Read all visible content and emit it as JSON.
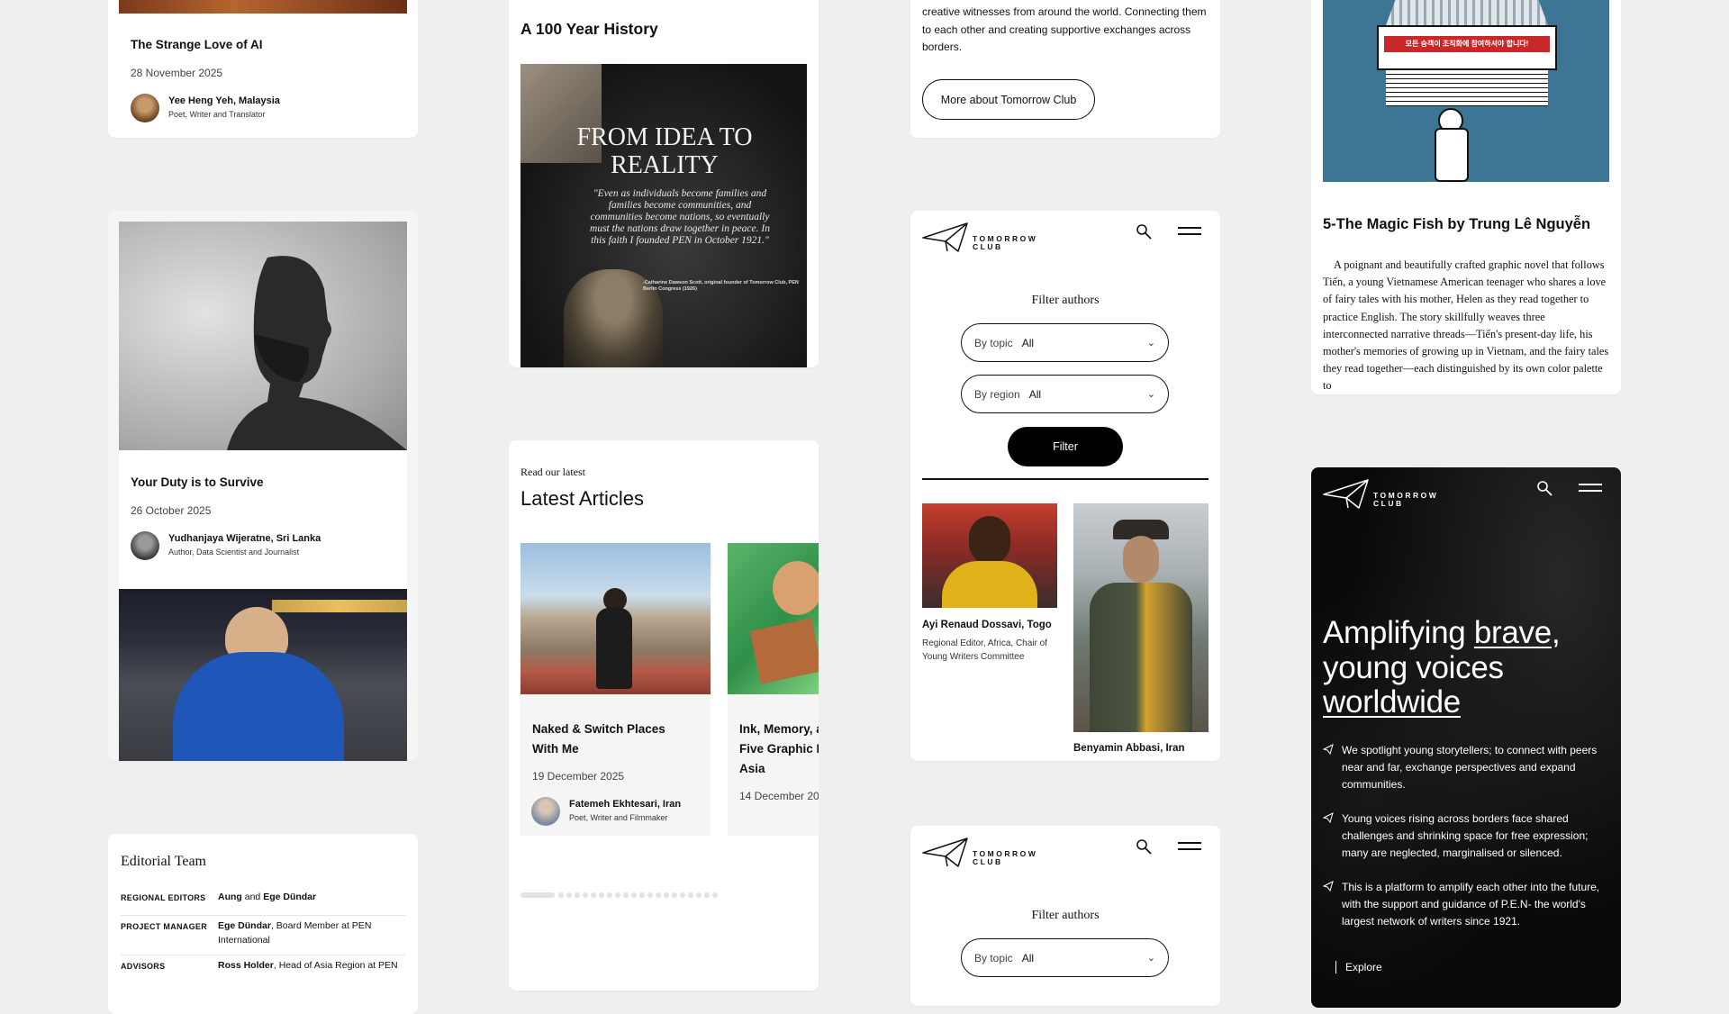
{
  "card1": {
    "title": "The Strange Love of AI",
    "date": "28 November 2025",
    "author_name": "Yee Heng Yeh, Malaysia",
    "author_role": "Poet, Writer and Translator"
  },
  "card2": {
    "title": "Your Duty is to Survive",
    "date": "26 October 2025",
    "author_name": "Yudhanjaya Wijeratne, Sri Lanka",
    "author_role": "Author, Data Scientist and Journalist"
  },
  "editorial": {
    "heading": "Editorial Team",
    "rows": [
      {
        "label": "REGIONAL EDITORS",
        "name1": "Aung",
        "joiner": " and ",
        "name2": "Ege Dündar",
        "rest": ""
      },
      {
        "label": "PROJECT MANAGER",
        "name1": "Ege Dündar",
        "joiner": "",
        "name2": "",
        "rest": ", Board Member at PEN International"
      },
      {
        "label": "ADVISORS",
        "name1": "Ross Holder",
        "joiner": "",
        "name2": "",
        "rest": ", Head of Asia Region at PEN"
      }
    ]
  },
  "history": {
    "heading": "A 100 Year History",
    "poster_title": "FROM IDEA TO REALITY",
    "poster_quote": "\"Even as individuals become families and families become communities, and communities become nations, so eventually must the nations draw together in peace. In this faith I founded PEN in October 1921.\"",
    "poster_credit": "-Catharine Dawson Scott, original founder of Tomorrow Club, PEN Berlin Congress (1926)"
  },
  "latest": {
    "eyebrow": "Read our latest",
    "heading": "Latest Articles",
    "article1": {
      "title": "Naked & Switch Places With Me",
      "date": "19 December 2025",
      "author_name": "Fatemeh Ekhtesari, Iran",
      "author_role": "Poet, Writer and Filmmaker"
    },
    "article2": {
      "title": "Ink, Memory, a Five Graphic N Asia",
      "date": "14 December 20"
    },
    "dots_count": 20
  },
  "about": {
    "text": "creative witnesses from around the world. Connecting them to each other and creating supportive exchanges across borders.",
    "button": "More about Tomorrow Club"
  },
  "brand": {
    "line1": "TOMORROW",
    "line2": "CLUB"
  },
  "filter1": {
    "heading": "Filter authors",
    "topic_label": "By topic",
    "topic_value": "All",
    "region_label": "By region",
    "region_value": "All",
    "button": "Filter",
    "authors": [
      {
        "name": "Ayi Renaud Dossavi, Togo",
        "role": "Regional Editor, Africa, Chair of Young Writers Committee"
      },
      {
        "name": "Benyamin Abbasi, Iran",
        "role": ""
      }
    ]
  },
  "filter2": {
    "heading": "Filter authors",
    "topic_label": "By topic",
    "topic_value": "All"
  },
  "fish": {
    "comic_sign": "모든 승객이 조직화에 참여하셔야 합니다!",
    "title": "5-The Magic Fish by Trung Lê Nguyễn",
    "body": "A poignant and beautifully crafted graphic novel that follows Tiến, a young Vietnamese American teenager who shares a love of fairy tales with his mother, Helen as they read together to practice English. The story skillfully weaves three interconnected narrative threads—Tiến's present-day life, his mother's memories of growing up in Vietnam, and the fairy tales they read together—each distinguished by its own color palette to"
  },
  "hero": {
    "h_part1": "Amplifying ",
    "h_brave": "brave",
    "h_part2": ",",
    "h_line2": "young voices",
    "h_worldwide": "worldwide",
    "bullets": [
      "We spotlight young storytellers; to connect with peers near and far, exchange perspectives and expand communities.",
      "Young voices rising across borders face shared challenges and shrinking space for free expression; many are neglected, marginalised or silenced.",
      "This is a platform to amplify each other into the future, with the support and guidance of P.E.N- the world's largest network of writers since 1921."
    ],
    "explore": "Explore"
  },
  "colors": {
    "page_bg": "#eef0f0",
    "hero_bg": "#080808",
    "fish_comic_bg": "#3d7594",
    "ink": "#111111"
  }
}
